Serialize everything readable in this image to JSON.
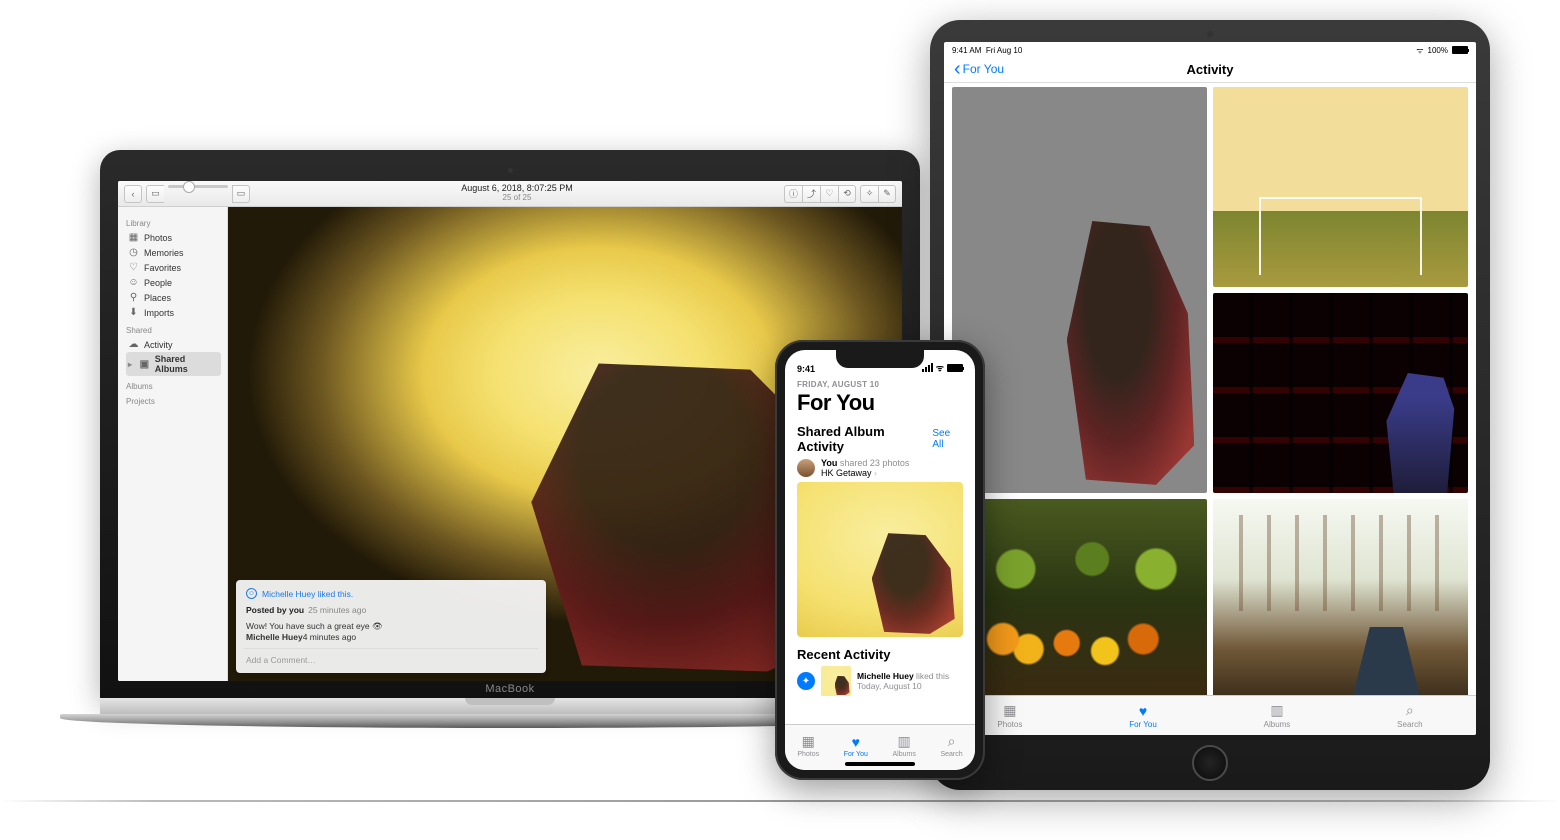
{
  "macbook": {
    "device_label": "MacBook",
    "toolbar": {
      "title": "August 6, 2018, 8:07:25 PM",
      "subtitle": "25 of 25"
    },
    "sidebar": {
      "sections": [
        {
          "heading": "Library",
          "items": [
            {
              "icon": "photos-icon",
              "label": "Photos"
            },
            {
              "icon": "memories-icon",
              "label": "Memories"
            },
            {
              "icon": "heart-icon",
              "label": "Favorites"
            },
            {
              "icon": "person-icon",
              "label": "People"
            },
            {
              "icon": "pin-icon",
              "label": "Places"
            },
            {
              "icon": "download-icon",
              "label": "Imports"
            }
          ]
        },
        {
          "heading": "Shared",
          "items": [
            {
              "icon": "cloud-icon",
              "label": "Activity"
            },
            {
              "icon": "folder-icon",
              "label": "Shared Albums",
              "selected": true,
              "disclosure": true
            }
          ]
        },
        {
          "heading": "Albums",
          "items": []
        },
        {
          "heading": "Projects",
          "items": []
        }
      ]
    },
    "overlay": {
      "liked_text": "Michelle Huey liked this.",
      "posted_by": "Posted by you",
      "posted_ago": "25 minutes ago",
      "comment_text": "Wow! You have such a great eye 👁",
      "comment_author": "Michelle Huey",
      "comment_ago": "4 minutes ago",
      "add_comment_placeholder": "Add a Comment…"
    }
  },
  "ipad": {
    "status": {
      "time": "9:41 AM",
      "date": "Fri Aug 10",
      "battery": "100%"
    },
    "header": {
      "back": "For You",
      "title": "Activity"
    },
    "tabs": [
      {
        "icon": "photos-tab-icon",
        "label": "Photos"
      },
      {
        "icon": "foryou-tab-icon",
        "label": "For You",
        "active": true
      },
      {
        "icon": "albums-tab-icon",
        "label": "Albums"
      },
      {
        "icon": "search-tab-icon",
        "label": "Search"
      }
    ]
  },
  "iphone": {
    "status": {
      "time": "9:41"
    },
    "date_line": "FRIDAY, AUGUST 10",
    "page_title": "For You",
    "shared": {
      "section_title": "Shared Album Activity",
      "see_all": "See All",
      "line1_prefix": "You",
      "line1_rest": " shared 23 photos",
      "line2": "HK Getaway",
      "chevron": "›"
    },
    "recent": {
      "section_title": "Recent Activity",
      "line1_name": "Michelle Huey",
      "line1_rest": " liked this",
      "line2": "Today, August 10"
    },
    "tabs": [
      {
        "icon": "photos-tab-icon",
        "label": "Photos"
      },
      {
        "icon": "foryou-tab-icon",
        "label": "For You",
        "active": true
      },
      {
        "icon": "albums-tab-icon",
        "label": "Albums"
      },
      {
        "icon": "search-tab-icon",
        "label": "Search"
      }
    ]
  }
}
